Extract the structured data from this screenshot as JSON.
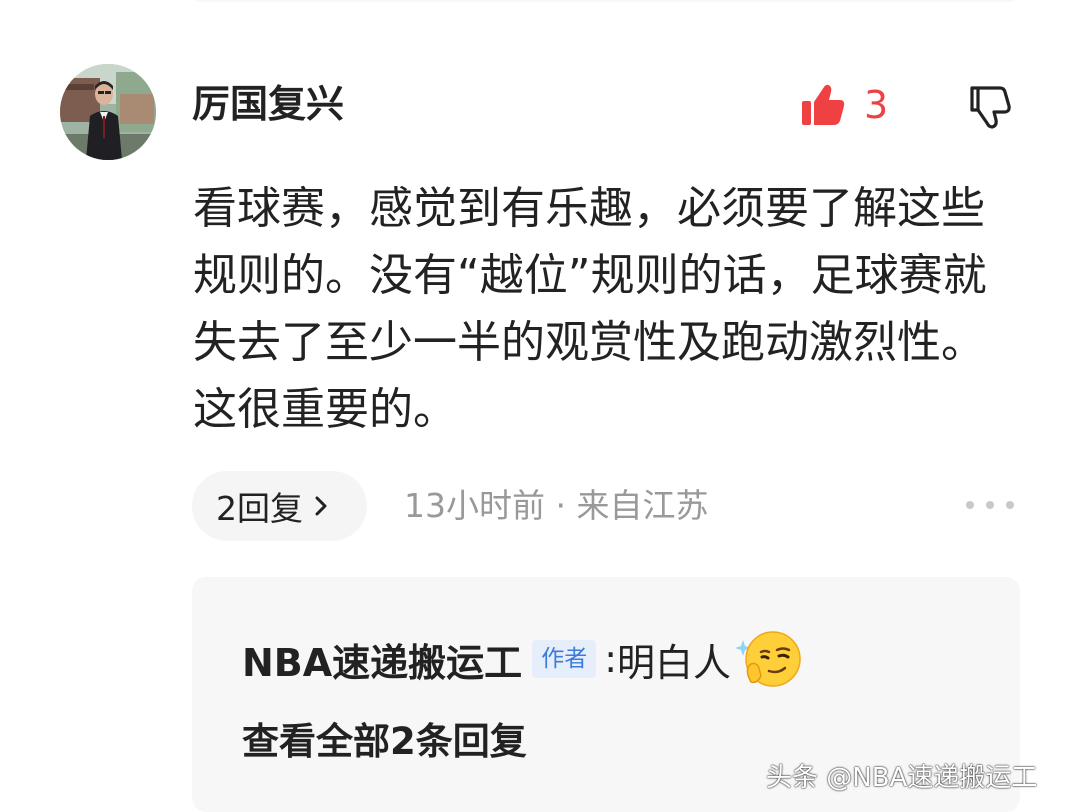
{
  "comment": {
    "username": "厉国复兴",
    "like_count": "3",
    "body": "看球赛，感觉到有乐趣，必须要了解这些规则的。没有“越位”规则的话，足球赛就失去了至少一半的观赏性及跑动激烈性。这很重要的。",
    "reply_count_label": "2回复",
    "meta": "13小时前 · 来自江苏",
    "icons": {
      "avatar": "user-avatar-photo",
      "like": "thumbs-up-filled-icon",
      "dislike": "thumbs-down-outline-icon",
      "chevron": "chevron-right-icon",
      "more": "more-dots-icon"
    }
  },
  "reply_preview": {
    "author": "NBA速递搬运工",
    "badge": "作者",
    "colon": ":",
    "text": "明白人",
    "emoji": "smirk-emoji-icon",
    "view_all": "查看全部2条回复"
  },
  "watermark": "头条 @NBA速递搬运工",
  "colors": {
    "like_red": "#f04142",
    "meta_gray": "#999999",
    "badge_blue": "#3d7bd9",
    "card_bg": "#f7f7f7"
  }
}
